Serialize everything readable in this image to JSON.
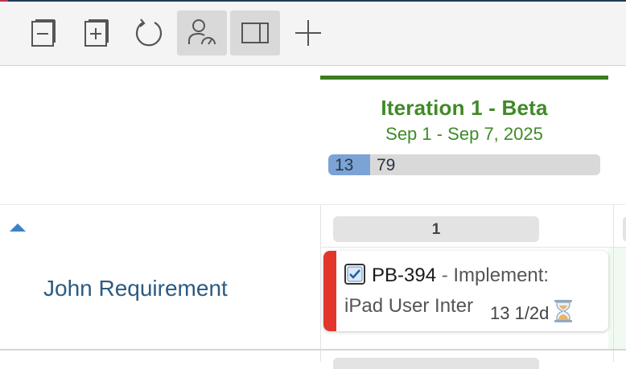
{
  "toolbar": {
    "buttons": [
      {
        "icon": "collapse-all-icon",
        "active": false
      },
      {
        "icon": "expand-all-icon",
        "active": false
      },
      {
        "icon": "refresh-icon",
        "active": false
      },
      {
        "icon": "user-velocity-icon",
        "active": true
      },
      {
        "icon": "split-panel-icon",
        "active": true
      },
      {
        "icon": "plus-icon",
        "active": false
      }
    ]
  },
  "iteration": {
    "title": "Iteration 1 - Beta",
    "dates": "Sep 1 - Sep 7, 2025",
    "progress_done": "13",
    "progress_rest": "79",
    "progress_fraction": 0.155,
    "accent_color": "#3a7d1e"
  },
  "swimlane": {
    "label": "John Requirement",
    "column_count": "1"
  },
  "card": {
    "id": "PB-394",
    "separator": " - ",
    "title_part1": "Implement:",
    "title_part2": "iPad User Inter",
    "meta": "13 1/2d",
    "status_color": "#e2362a",
    "type_icon": "checkbox-icon",
    "status_icon": "hourglass-icon"
  }
}
